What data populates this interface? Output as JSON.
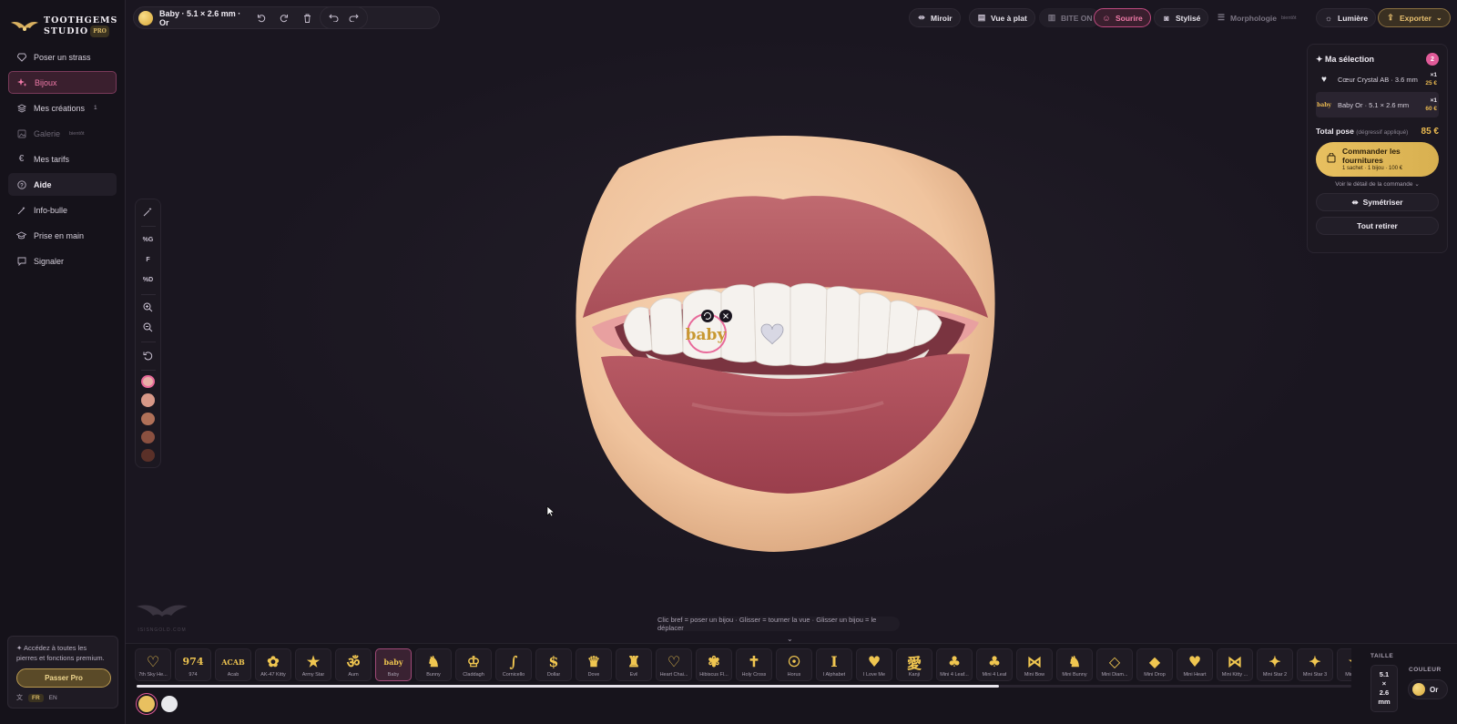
{
  "brand": {
    "name_line1": "TOOTHGEMS",
    "name_line2": "STUDIO",
    "badge": "PRO"
  },
  "sidebar": {
    "items": [
      {
        "label": "Poser un strass",
        "icon": "diamond-icon"
      },
      {
        "label": "Bijoux",
        "icon": "sparkles-icon"
      },
      {
        "label": "Mes créations",
        "icon": "layers-icon",
        "count": "1"
      },
      {
        "label": "Galerie",
        "icon": "image-icon",
        "tag": "bientôt"
      },
      {
        "label": "Mes tarifs",
        "icon": "euro-icon"
      },
      {
        "label": "Aide",
        "icon": "help-icon"
      },
      {
        "label": "Info-bulle",
        "icon": "wand-icon"
      },
      {
        "label": "Prise en main",
        "icon": "graduation-cap-icon"
      },
      {
        "label": "Signaler",
        "icon": "message-icon"
      }
    ],
    "promo": {
      "text": "✦ Accédez à toutes les pierres et fonctions premium.",
      "button": "Passer Pro"
    },
    "lang": {
      "fr": "FR",
      "en": "EN"
    }
  },
  "topbar": {
    "piece_label": "Baby · 5.1 × 2.6 mm · Or",
    "miroir": "Miroir",
    "vue_plat": "Vue à plat",
    "bite_on": "BITE ON",
    "sourire": "Sourire",
    "stylise": "Stylisé",
    "morphologie": "Morphologie",
    "morphologie_tag": "bientôt",
    "lumiere": "Lumière",
    "exporter": "Exporter"
  },
  "tools": {
    "g": "%G",
    "f": "F",
    "d": "%D",
    "swatches": [
      "#e8b0a8",
      "#d89888",
      "#b07058",
      "#8a5040",
      "#5a3028"
    ]
  },
  "canvas": {
    "hint": "Clic bref = poser un bijou · Glisser = tourner la vue · Glisser un bijou = le déplacer",
    "gem_label": "baby",
    "watermark": "ISISNGOLD.COM"
  },
  "selection": {
    "title": "✦ Ma sélection",
    "count": "2",
    "items": [
      {
        "name": "Cœur Crystal AB · 3.6 mm",
        "qty": "×1",
        "price": "25 €",
        "thumb": "heart-icon",
        "thumb_text": ""
      },
      {
        "name": "Baby Or · 5.1 × 2.6 mm",
        "qty": "×1",
        "price": "60 €",
        "thumb": "baby-gem-icon",
        "thumb_text": "baby"
      }
    ],
    "total_label": "Total pose",
    "total_sub": "(dégressif appliqué)",
    "total_amount": "85 €",
    "order_title": "Commander les fournitures",
    "order_sub": "1 sachet · 1 bijou · 100 €",
    "detail_link": "Voir le détail de la commande",
    "symetriser": "Symétriser",
    "retirer": "Tout retirer"
  },
  "catalog": {
    "items": [
      {
        "label": "7th Sky He...",
        "glyph": "♡"
      },
      {
        "label": "974",
        "glyph": "974"
      },
      {
        "label": "Acab",
        "glyph": "ACAB"
      },
      {
        "label": "AK-47 Kitty",
        "glyph": "✿"
      },
      {
        "label": "Army Star",
        "glyph": "★"
      },
      {
        "label": "Aum",
        "glyph": "ॐ"
      },
      {
        "label": "Baby",
        "glyph": "baby",
        "active": true
      },
      {
        "label": "Bunny",
        "glyph": "♞"
      },
      {
        "label": "Claddagh",
        "glyph": "♔"
      },
      {
        "label": "Cornicello",
        "glyph": "∫"
      },
      {
        "label": "Dollar",
        "glyph": "$"
      },
      {
        "label": "Dove",
        "glyph": "♛"
      },
      {
        "label": "Evil",
        "glyph": "♜"
      },
      {
        "label": "Heart Chai...",
        "glyph": "♡"
      },
      {
        "label": "Hibiscus Fl...",
        "glyph": "✾"
      },
      {
        "label": "Holy Cross",
        "glyph": "✝"
      },
      {
        "label": "Horus",
        "glyph": "☉"
      },
      {
        "label": "I Alphabet",
        "glyph": "I"
      },
      {
        "label": "I Love Me",
        "glyph": "♥"
      },
      {
        "label": "Kanji",
        "glyph": "愛"
      },
      {
        "label": "Mini 4 Leaf...",
        "glyph": "♣"
      },
      {
        "label": "Mini 4 Leaf",
        "glyph": "♣"
      },
      {
        "label": "Mini Bow",
        "glyph": "⋈"
      },
      {
        "label": "Mini Bunny",
        "glyph": "♞"
      },
      {
        "label": "Mini Diam...",
        "glyph": "◇"
      },
      {
        "label": "Mini Drop",
        "glyph": "◆"
      },
      {
        "label": "Mini Heart",
        "glyph": "♥"
      },
      {
        "label": "Mini Kitty ...",
        "glyph": "⋈"
      },
      {
        "label": "Mini Star 2",
        "glyph": "✦"
      },
      {
        "label": "Mini Star 3",
        "glyph": "✦"
      },
      {
        "label": "Mini St...",
        "glyph": "★"
      }
    ],
    "scroll_fraction": 0.71
  },
  "tray": {
    "taille_label": "TAILLE",
    "size_value": "5.1 × 2.6 mm",
    "size_l1": "5.1",
    "size_l2": "×",
    "size_l3": "2.6",
    "size_l4": "mm",
    "couleur_label": "COULEUR",
    "couleur_value": "Or",
    "colors": [
      "#e8c060",
      "#e8e8ec"
    ]
  }
}
